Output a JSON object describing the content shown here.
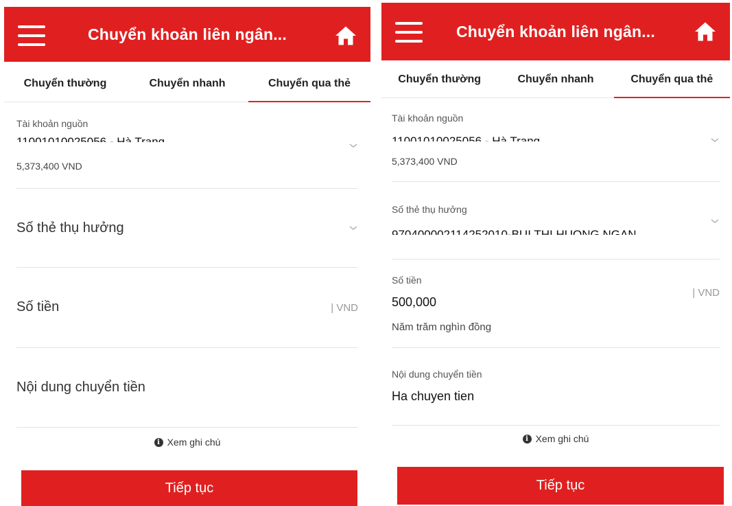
{
  "colors": {
    "brand_red": "#e02020",
    "divider": "#e3e3e3"
  },
  "icons": {
    "menu": "hamburger-menu-icon",
    "home": "home-icon",
    "dropdown": "chevron-down-icon",
    "info": "info-circle-icon"
  },
  "left": {
    "header": {
      "title": "Chuyển khoản liên ngân..."
    },
    "tabs": [
      "Chuyển thường",
      "Chuyển nhanh",
      "Chuyển qua thẻ"
    ],
    "active_tab_index": 2,
    "source_account": {
      "label": "Tài khoản nguồn",
      "account_text": "11001010025056 - Hà Trang",
      "balance": "5,373,400 VND"
    },
    "card_number": {
      "placeholder": "Số thẻ thụ hưởng"
    },
    "amount": {
      "placeholder": "Số tiền",
      "unit": "| VND"
    },
    "content": {
      "placeholder": "Nội dung chuyển tiền"
    },
    "note": {
      "label": "Xem ghi chú",
      "icon_glyph": "i"
    },
    "continue_button": "Tiếp tục"
  },
  "right": {
    "header": {
      "title": "Chuyển khoản liên ngân..."
    },
    "tabs": [
      "Chuyển thường",
      "Chuyển nhanh",
      "Chuyển qua thẻ"
    ],
    "active_tab_index": 2,
    "source_account": {
      "label": "Tài khoản nguồn",
      "account_text": "11001010025056 - Hà Trang",
      "balance": "5,373,400 VND"
    },
    "card_number": {
      "label": "Số thẻ thụ hưởng",
      "value_text": "970400002114252010-BUI THI HUONG NGAN"
    },
    "amount": {
      "label": "Số tiền",
      "value": "500,000",
      "in_words": "Năm trăm nghìn đồng",
      "unit": "| VND"
    },
    "content": {
      "label": "Nội dung chuyển tiền",
      "value": "Ha chuyen tien"
    },
    "note": {
      "label": "Xem ghi chú",
      "icon_glyph": "i"
    },
    "continue_button": "Tiếp tục"
  }
}
